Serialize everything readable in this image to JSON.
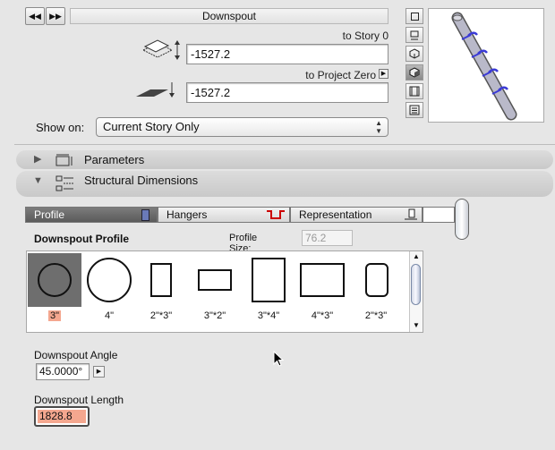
{
  "header": {
    "nav_prev": "◀◀",
    "nav_next": "▶▶",
    "title": "Downspout"
  },
  "elevation": {
    "to_story_label": "to Story 0",
    "to_story_value": "-1527.2",
    "to_project_zero_label": "to Project Zero",
    "to_project_zero_value": "-1527.2"
  },
  "show_on": {
    "label": "Show on:",
    "selected": "Current Story Only"
  },
  "panels": {
    "parameters": "Parameters",
    "structural": "Structural Dimensions"
  },
  "tabs": [
    {
      "label": "Profile",
      "active": true
    },
    {
      "label": "Hangers",
      "active": false
    },
    {
      "label": "Representation",
      "active": false
    }
  ],
  "profile": {
    "title": "Downspout Profile",
    "size_label": "Profile Size:",
    "size_value": "76.2",
    "items": [
      {
        "label": "3\"",
        "shape": "circle",
        "selected": true
      },
      {
        "label": "4\"",
        "shape": "circle-large",
        "selected": false
      },
      {
        "label": "2\"*3\"",
        "shape": "rect-tall",
        "selected": false
      },
      {
        "label": "3\"*2\"",
        "shape": "rect-wide",
        "selected": false
      },
      {
        "label": "3\"*4\"",
        "shape": "rect-tall-large",
        "selected": false
      },
      {
        "label": "4\"*3\"",
        "shape": "rect-wide-large",
        "selected": false
      },
      {
        "label": "2\"*3\"",
        "shape": "rounded-tall",
        "selected": false
      }
    ]
  },
  "angle": {
    "label": "Downspout Angle",
    "value": "45.0000°"
  },
  "length": {
    "label": "Downspout Length",
    "value": "1828.8"
  },
  "colors": {
    "selection_highlight": "#f4a78f",
    "pipe_blue": "#3b3bd6"
  }
}
